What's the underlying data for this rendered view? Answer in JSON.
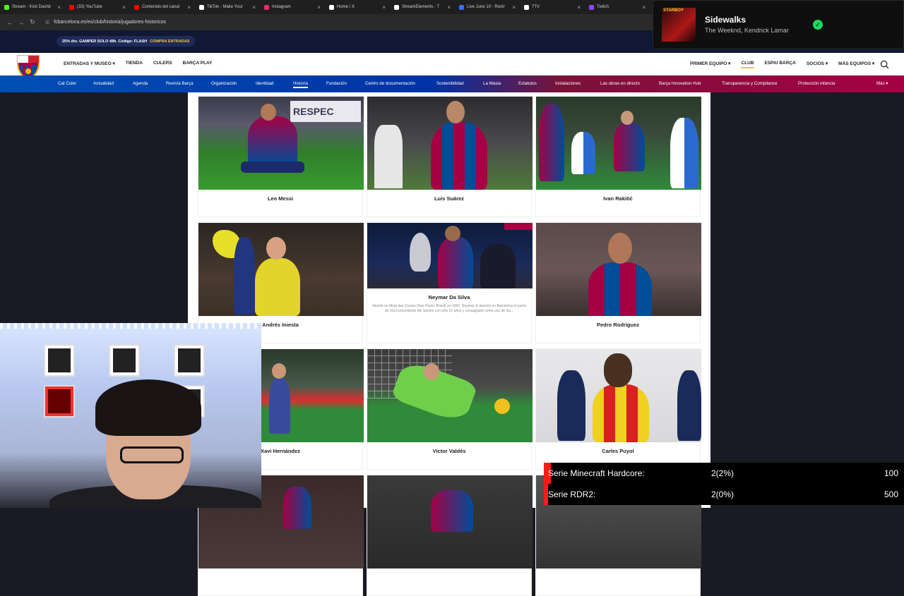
{
  "browser": {
    "tabs": [
      {
        "label": "Stream - Kick Dashb",
        "color": "#53fc18"
      },
      {
        "label": "(33) YouTube",
        "color": "#ff0000"
      },
      {
        "label": "Contenido del canal",
        "color": "#ff0000"
      },
      {
        "label": "TikTok - Make Your",
        "color": "#ffffff"
      },
      {
        "label": "Instagram",
        "color": "#e1306c"
      },
      {
        "label": "Home / X",
        "color": "#ffffff"
      },
      {
        "label": "StreamElements - T",
        "color": "#ffffff"
      },
      {
        "label": "Live June 10 - Restr",
        "color": "#3b6cff"
      },
      {
        "label": "7TV",
        "color": "#ffffff"
      },
      {
        "label": "Twitch",
        "color": "#9146ff"
      }
    ],
    "url": "fcbarcelona.es/es/club/historia/jugadores-historicos"
  },
  "promo": {
    "text": "25% dto. GAMPER SOLO 48h. Código: FLASH",
    "cta": "COMPRA ENTRADAS"
  },
  "header": {
    "left_nav": [
      "ENTRADAS Y MUSEO ▾",
      "TIENDA",
      "CULERS",
      "BARÇA PLAY"
    ],
    "right_nav": [
      "PRIMER EQUIPO ▾",
      "CLUB",
      "ESPAI BARÇA",
      "SOCIOS ▾",
      "MÁS EQUIPOS ▾"
    ],
    "active": "CLUB"
  },
  "subnav": {
    "items": [
      "Cat Culer",
      "Actualidad",
      "Agenda",
      "Revista Barça",
      "Organización",
      "Identidad",
      "Historia",
      "Fundación",
      "Centro de documentación",
      "Sostenibilidad",
      "La Masia",
      "Estatutos",
      "Instalaciones",
      "Las obras en directo",
      "Barça Innovation Hub",
      "Transparencia y Compliance",
      "Protección infancia",
      "Más ▾"
    ],
    "active": "Historia"
  },
  "players": [
    {
      "name": "Leo Messi"
    },
    {
      "name": "Luis Suárez"
    },
    {
      "name": "Ivan Rakitić"
    },
    {
      "name": "Andrés Iniesta"
    },
    {
      "name": "Neymar Da Silva",
      "desc": "Nacido en Mogi das Cruzes (Sao Paulo, Brasil) en 1992, Neymar Jr aterrizó en Barcelona en junio de 2013 procedente del Santos con sólo 21 años y consagrado como uno de los..."
    },
    {
      "name": "Pedro Rodríguez"
    },
    {
      "name": "Xavi Hernández"
    },
    {
      "name": "Víctor Valdés"
    },
    {
      "name": "Carles Puyol"
    }
  ],
  "spotify": {
    "album_text": "STARBOY",
    "title": "Sidewalks",
    "artist": "The Weeknd, Kendrick Lamar"
  },
  "goals": [
    {
      "label": "Serie Minecraft Hardcore:",
      "value": "2(2%)",
      "target": "100",
      "progress": 0.02
    },
    {
      "label": "Serie RDR2:",
      "value": "2(0%)",
      "target": "500",
      "progress": 0.004
    }
  ]
}
